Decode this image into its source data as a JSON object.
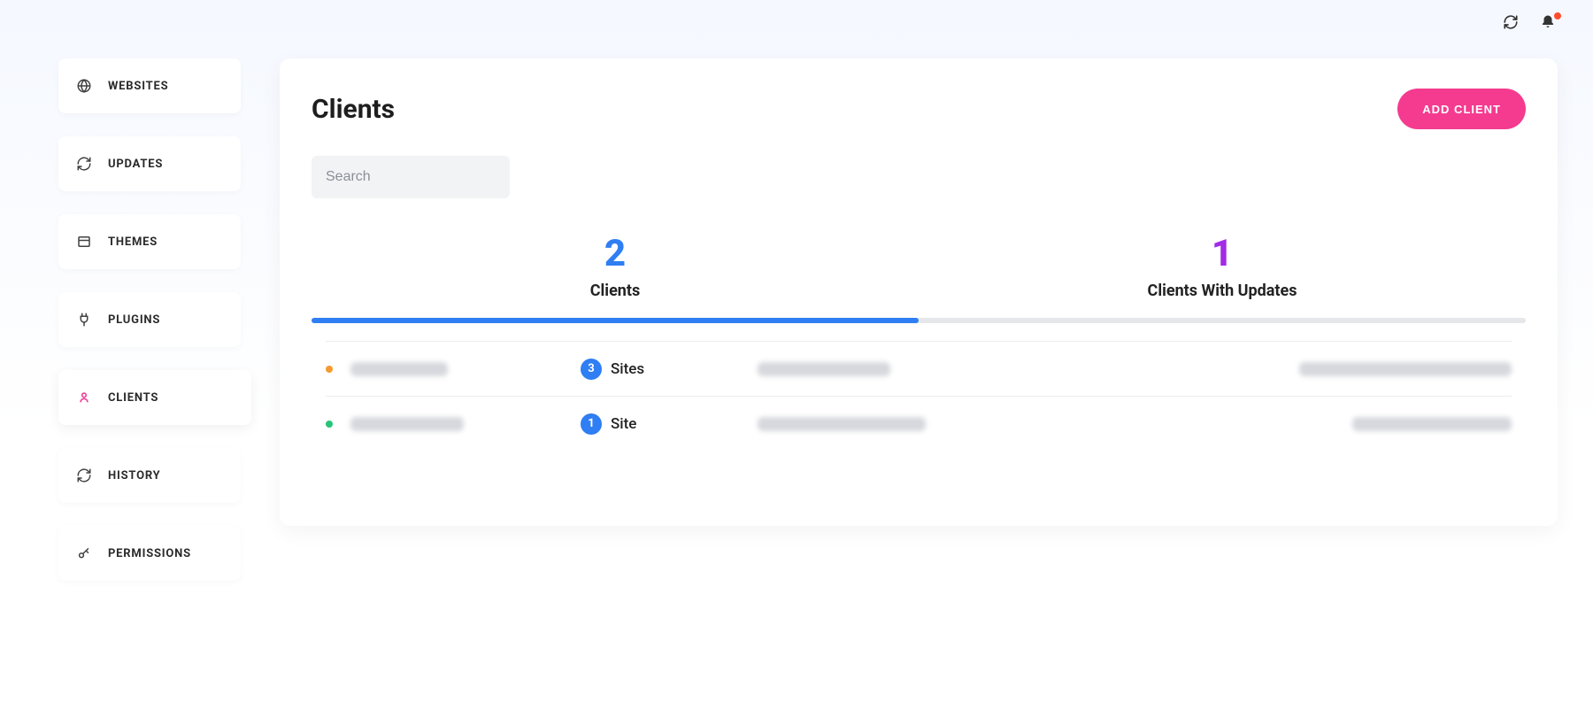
{
  "topbar": {
    "refresh_icon": "refresh",
    "bell_icon": "bell",
    "has_notification": true
  },
  "sidebar": {
    "items": [
      {
        "icon": "globe",
        "label": "WEBSITES"
      },
      {
        "icon": "sync",
        "label": "UPDATES"
      },
      {
        "icon": "window",
        "label": "THEMES"
      },
      {
        "icon": "plug",
        "label": "PLUGINS"
      },
      {
        "icon": "user",
        "label": "CLIENTS",
        "active": true
      },
      {
        "icon": "sync",
        "label": "HISTORY"
      },
      {
        "icon": "key",
        "label": "PERMISSIONS"
      }
    ]
  },
  "page": {
    "title": "Clients",
    "add_button": "ADD CLIENT",
    "search_placeholder": "Search"
  },
  "tabs": [
    {
      "count": "2",
      "label": "Clients",
      "color": "blue",
      "active": true
    },
    {
      "count": "1",
      "label": "Clients With Updates",
      "color": "purple",
      "active": false
    }
  ],
  "rows": [
    {
      "status": "orange",
      "name": "■■■■■■■",
      "sites_count": "3",
      "sites_label": "Sites",
      "company": "■■■■■■■■■",
      "email": "■■■■■■■■■"
    },
    {
      "status": "green",
      "name": "■■■■■■■■",
      "sites_count": "1",
      "sites_label": "Site",
      "company": "■■■■■■■■■",
      "email": "■■■■■■■"
    }
  ]
}
